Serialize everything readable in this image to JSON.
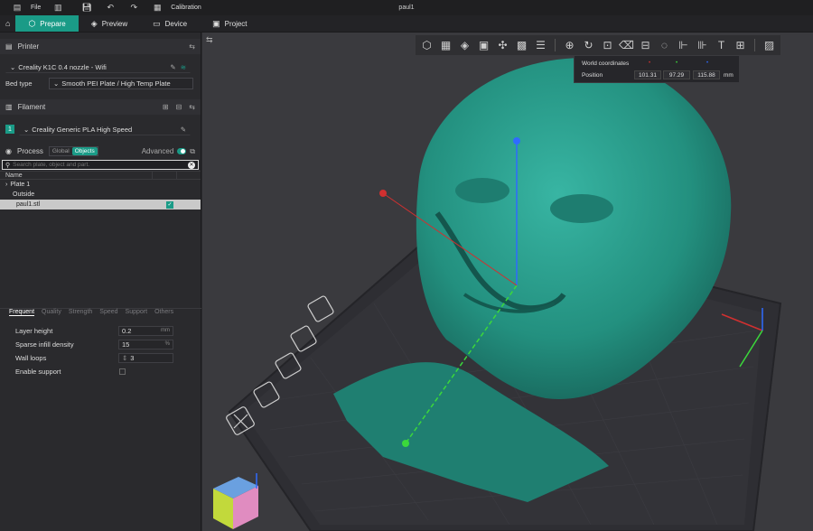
{
  "titlebar": {
    "file_label": "File",
    "calibration_label": "Calibration",
    "window_title": "paul1"
  },
  "tabs": [
    {
      "label": "Prepare",
      "icon": "cube-icon",
      "active": true
    },
    {
      "label": "Preview",
      "icon": "layers-icon",
      "active": false
    },
    {
      "label": "Device",
      "icon": "monitor-icon",
      "active": false
    },
    {
      "label": "Project",
      "icon": "project-icon",
      "active": false
    }
  ],
  "printer": {
    "section_label": "Printer",
    "name": "Creality K1C 0.4 nozzle - Wifi",
    "bed_label": "Bed type",
    "bed_value": "Smooth PEI Plate / High Temp Plate"
  },
  "filament": {
    "section_label": "Filament",
    "slot": "1",
    "name": "Creality Generic PLA High Speed"
  },
  "process": {
    "section_label": "Process",
    "seg_global": "Global",
    "seg_objects": "Objects",
    "advanced_label": "Advanced",
    "search_placeholder": "Search plate, object and part."
  },
  "object_list": {
    "name_header": "Name",
    "rows": [
      {
        "label": "Plate 1",
        "selected": false
      },
      {
        "label": "Outside",
        "selected": false
      },
      {
        "label": "paul1.stl",
        "selected": true
      }
    ]
  },
  "param_tabs": [
    "Frequent",
    "Quality",
    "Strength",
    "Speed",
    "Support",
    "Others"
  ],
  "params": {
    "layer_height_label": "Layer height",
    "layer_height_value": "0.2",
    "layer_height_unit": "mm",
    "sparse_label": "Sparse infill density",
    "sparse_value": "15",
    "sparse_unit": "%",
    "wall_label": "Wall loops",
    "wall_value": "3",
    "support_label": "Enable support"
  },
  "coords": {
    "header": "World coordinates",
    "position_label": "Position",
    "x": "101.31",
    "y": "97.29",
    "z": "115.88",
    "unit": "mm"
  },
  "colors": {
    "accent": "#1a9b87",
    "model": "#2a9d8f",
    "plate": "#2d2d31"
  }
}
